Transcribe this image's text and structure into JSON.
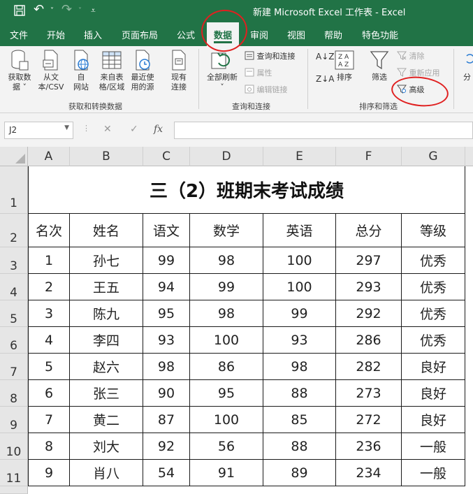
{
  "titlebar": {
    "title": "新建 Microsoft Excel 工作表  -  Excel",
    "save_icon": "save-icon",
    "undo_glyph": "↶",
    "redo_glyph": "↷",
    "dd_glyph": "˅",
    "qa_more_glyph": "⩡"
  },
  "tabs": [
    "文件",
    "开始",
    "插入",
    "页面布局",
    "公式",
    "数据",
    "审阅",
    "视图",
    "帮助",
    "特色功能"
  ],
  "ribbon": {
    "get_data": {
      "line1": "获取数",
      "line2": "据 ˅"
    },
    "from_text": {
      "line1": "从文",
      "line2": "本/CSV"
    },
    "from_web": {
      "line1": "自",
      "line2": "网站"
    },
    "from_table": {
      "line1": "来自表",
      "line2": "格/区域"
    },
    "recent": {
      "line1": "最近使",
      "line2": "用的源"
    },
    "existing": {
      "line1": "现有",
      "line2": "连接"
    },
    "group1_label": "获取和转换数据",
    "refresh_all": {
      "line1": "全部刷新",
      "line2": "˅"
    },
    "queries_connections": "查询和连接",
    "properties": "属性",
    "edit_links": "编辑链接",
    "group2_label": "查询和连接",
    "sort_az": "A↓Z",
    "sort_za": "Z↓A",
    "sort": "排序",
    "filter": "筛选",
    "clear": "清除",
    "reapply": "重新应用",
    "advanced": "高级",
    "group3_label": "排序和筛选",
    "split_partial": "分"
  },
  "formula_bar": {
    "namebox": "J2",
    "cancel": "✕",
    "enter": "✓",
    "fx": "fx",
    "value": ""
  },
  "columns": [
    "A",
    "B",
    "C",
    "D",
    "E",
    "F",
    "G"
  ],
  "rows": [
    "1",
    "2",
    "3",
    "4",
    "5",
    "6",
    "7",
    "8",
    "9",
    "10",
    "11"
  ],
  "sheet_title": "三（2）班期末考试成绩",
  "table_headers": [
    "名次",
    "姓名",
    "语文",
    "数学",
    "英语",
    "总分",
    "等级"
  ],
  "table_rows": [
    [
      "1",
      "孙七",
      "99",
      "98",
      "100",
      "297",
      "优秀"
    ],
    [
      "2",
      "王五",
      "94",
      "99",
      "100",
      "293",
      "优秀"
    ],
    [
      "3",
      "陈九",
      "95",
      "98",
      "99",
      "292",
      "优秀"
    ],
    [
      "4",
      "李四",
      "93",
      "100",
      "93",
      "286",
      "优秀"
    ],
    [
      "5",
      "赵六",
      "98",
      "86",
      "98",
      "282",
      "良好"
    ],
    [
      "6",
      "张三",
      "90",
      "95",
      "88",
      "273",
      "良好"
    ],
    [
      "7",
      "黄二",
      "87",
      "100",
      "85",
      "272",
      "良好"
    ],
    [
      "8",
      "刘大",
      "92",
      "56",
      "88",
      "236",
      "一般"
    ],
    [
      "9",
      "肖八",
      "54",
      "91",
      "89",
      "234",
      "一般"
    ]
  ],
  "colors": {
    "excel_green": "#217346",
    "annotation_red": "#e02020"
  }
}
